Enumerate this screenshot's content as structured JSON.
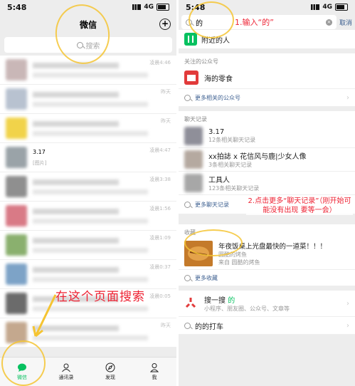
{
  "left": {
    "status_time": "5:48",
    "network": "4G",
    "title": "微信",
    "search_placeholder": "搜索",
    "chat_times": [
      "凌晨4:46",
      "昨天",
      "昨天",
      "凌晨4:47",
      "凌晨3:38",
      "凌晨1:56",
      "凌晨1:09",
      "凌晨0:37",
      "凌晨0:05",
      "昨天"
    ],
    "chat_snippets": [
      "3.17",
      "[图片]"
    ],
    "annotation": "在这个页面搜索",
    "tabs": [
      "微信",
      "通讯录",
      "发现",
      "我"
    ]
  },
  "right": {
    "status_time": "5:48",
    "network": "4G",
    "query": "的",
    "cancel": "取消",
    "annotation_1": "1.输入“的”",
    "nearby_label": "附近的人",
    "public_header": "关注的公众号",
    "public_name": "海的零食",
    "more_public": "更多相关的公众号",
    "chat_header": "聊天记录",
    "chat_results": [
      {
        "title": "3.17",
        "sub": "12条相关聊天记录"
      },
      {
        "title": "xx拍誌 x 花信风与鹿|少女人像",
        "sub": "3条相关聊天记录"
      },
      {
        "title": "工具人",
        "sub": "123条相关聊天记录"
      }
    ],
    "more_chats": "更多聊天记录",
    "annotation_2": "2.点击更多“聊天记录”（刚开始可能没有出现 要等一会）",
    "fav_header": "收藏",
    "fav_title": "年夜饭桌上光盘最快的一道菜！！！",
    "fav_sub1": "圆酷的烤鱼",
    "fav_sub2": "来自 圆酷的烤鱼",
    "more_fav": "更多收藏",
    "sousou_title": "搜一搜",
    "sousou_query": "的",
    "sousou_sub": "小程序、朋友圈、公众号、文章等",
    "last_row": "的的打车"
  }
}
